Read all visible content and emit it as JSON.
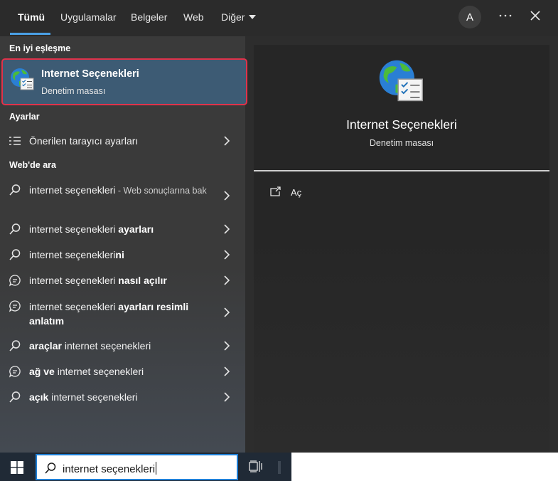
{
  "tabs": [
    {
      "label": "Tümü",
      "active": true
    },
    {
      "label": "Uygulamalar",
      "active": false
    },
    {
      "label": "Belgeler",
      "active": false
    },
    {
      "label": "Web",
      "active": false
    },
    {
      "label": "Diğer",
      "active": false
    }
  ],
  "header": {
    "avatar_letter": "A",
    "more_icon": "ellipsis-icon",
    "close_icon": "close-icon"
  },
  "sections": {
    "best_match": "En iyi eşleşme",
    "settings": "Ayarlar",
    "web": "Web'de ara"
  },
  "best_match": {
    "title": "Internet Seçenekleri",
    "subtitle": "Denetim masası",
    "icon": "internet-options-icon"
  },
  "settings_items": [
    {
      "text": "Önerilen tarayıcı ayarları",
      "icon": "list-settings-icon"
    }
  ],
  "web_items": [
    {
      "plain": "internet seçenekleri",
      "bold": "",
      "suffix": " - Web sonuçlarına bak",
      "icon": "search-icon"
    },
    {
      "plain": "internet seçenekleri ",
      "bold": "ayarları",
      "suffix": "",
      "icon": "search-icon"
    },
    {
      "plain": "internet seçenekleri",
      "bold": "ni",
      "suffix": "",
      "icon": "search-icon"
    },
    {
      "plain": "internet seçenekleri ",
      "bold": "nasıl açılır",
      "suffix": "",
      "icon": "chat-icon"
    },
    {
      "plain": "internet seçenekleri ",
      "bold": "ayarları resimli anlatım",
      "suffix": "",
      "icon": "chat-icon"
    },
    {
      "bold_first": "araçlar",
      "plain": " internet seçenekleri",
      "icon": "search-icon"
    },
    {
      "bold_first": "ağ ve",
      "plain": " internet seçenekleri",
      "icon": "chat-icon"
    },
    {
      "bold_first": "açık",
      "plain": " internet seçenekleri",
      "icon": "search-icon"
    }
  ],
  "preview": {
    "title": "Internet Seçenekleri",
    "subtitle": "Denetim masası",
    "open_label": "Aç",
    "icon": "internet-options-icon"
  },
  "taskbar": {
    "search_value": "internet seçenekleri",
    "start_icon": "windows-logo-icon",
    "taskview_icon": "task-view-icon"
  },
  "colors": {
    "accent": "#4aa0e6",
    "highlight_border": "#e0324a",
    "best_match_bg": "#3d5b74"
  }
}
